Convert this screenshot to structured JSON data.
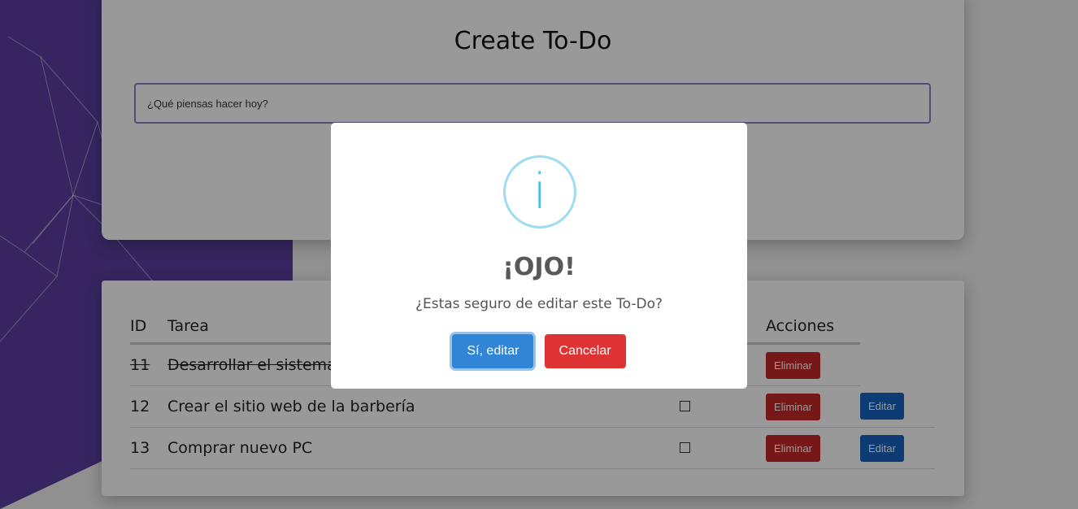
{
  "create": {
    "title": "Create To-Do",
    "input_placeholder": "¿Qué piensas hacer hoy?",
    "input_value": ""
  },
  "table": {
    "headers": {
      "id": "ID",
      "tarea": "Tarea",
      "acciones": "Acciones"
    },
    "rows": [
      {
        "id": "11",
        "tarea": "Desarrollar el sistema",
        "done": true,
        "delete_label": "Eliminar"
      },
      {
        "id": "12",
        "tarea": "Crear el sitio web de la barbería",
        "done": false,
        "delete_label": "Eliminar",
        "edit_label": "Editar"
      },
      {
        "id": "13",
        "tarea": "Comprar nuevo PC",
        "done": false,
        "delete_label": "Eliminar",
        "edit_label": "Editar"
      }
    ]
  },
  "modal": {
    "icon": "info-icon",
    "icon_glyph": "i",
    "title": "¡OJO!",
    "text": "¿Estas seguro de editar este To-Do?",
    "confirm_label": "Sí, editar",
    "cancel_label": "Cancelar"
  },
  "colors": {
    "background_purple": "#5a3fa0",
    "info": "#3fc3ee",
    "confirm": "#3085d6",
    "cancel": "#dd3333",
    "delete": "#c62828",
    "edit": "#1565c0"
  }
}
